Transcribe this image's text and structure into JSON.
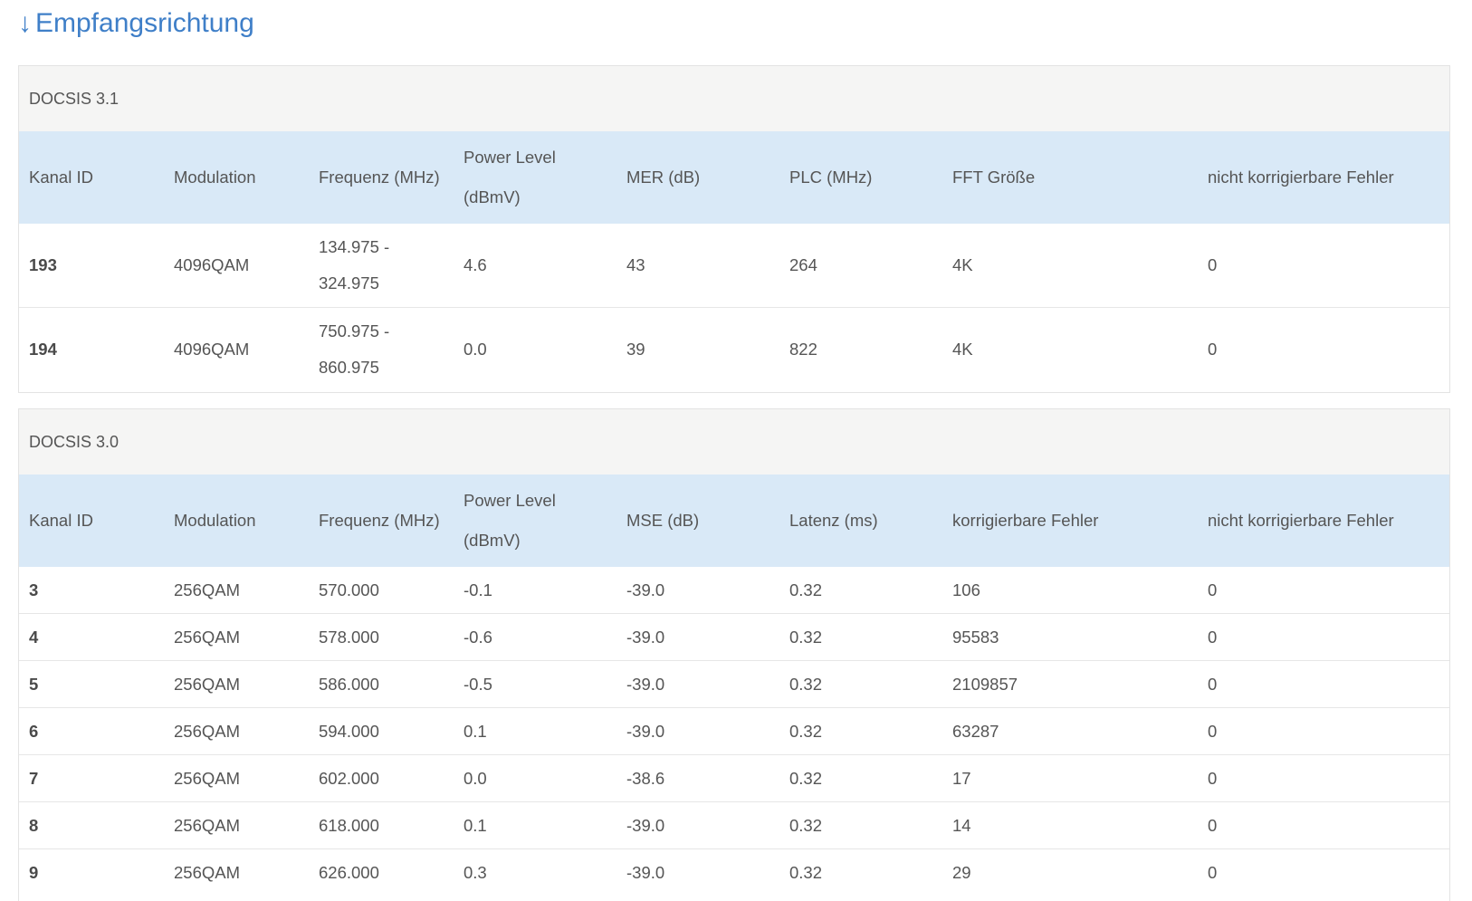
{
  "heading": {
    "arrow": "↓",
    "title": "Empfangsrichtung"
  },
  "docsis31": {
    "title": "DOCSIS 3.1",
    "columns": {
      "kanal_id": "Kanal ID",
      "modulation": "Modulation",
      "frequenz": "Frequenz (MHz)",
      "power": "Power Level (dBmV)",
      "mer": "MER (dB)",
      "plc": "PLC (MHz)",
      "fft": "FFT Größe",
      "nicht_korr": "nicht korrigierbare Fehler"
    },
    "rows": [
      {
        "kanal_id": "193",
        "modulation": "4096QAM",
        "frequenz": "134.975 - 324.975",
        "power": "4.6",
        "mer": "43",
        "plc": "264",
        "fft": "4K",
        "nicht_korr": "0"
      },
      {
        "kanal_id": "194",
        "modulation": "4096QAM",
        "frequenz": "750.975 - 860.975",
        "power": "0.0",
        "mer": "39",
        "plc": "822",
        "fft": "4K",
        "nicht_korr": "0"
      }
    ]
  },
  "docsis30": {
    "title": "DOCSIS 3.0",
    "columns": {
      "kanal_id": "Kanal ID",
      "modulation": "Modulation",
      "frequenz": "Frequenz (MHz)",
      "power": "Power Level (dBmV)",
      "mse": "MSE (dB)",
      "latenz": "Latenz (ms)",
      "korr": "korrigierbare Fehler",
      "nicht_korr": "nicht korrigierbare Fehler"
    },
    "rows": [
      {
        "kanal_id": "3",
        "modulation": "256QAM",
        "frequenz": "570.000",
        "power": "-0.1",
        "mse": "-39.0",
        "latenz": "0.32",
        "korr": "106",
        "nicht_korr": "0"
      },
      {
        "kanal_id": "4",
        "modulation": "256QAM",
        "frequenz": "578.000",
        "power": "-0.6",
        "mse": "-39.0",
        "latenz": "0.32",
        "korr": "95583",
        "nicht_korr": "0"
      },
      {
        "kanal_id": "5",
        "modulation": "256QAM",
        "frequenz": "586.000",
        "power": "-0.5",
        "mse": "-39.0",
        "latenz": "0.32",
        "korr": "2109857",
        "nicht_korr": "0"
      },
      {
        "kanal_id": "6",
        "modulation": "256QAM",
        "frequenz": "594.000",
        "power": "0.1",
        "mse": "-39.0",
        "latenz": "0.32",
        "korr": "63287",
        "nicht_korr": "0"
      },
      {
        "kanal_id": "7",
        "modulation": "256QAM",
        "frequenz": "602.000",
        "power": "0.0",
        "mse": "-38.6",
        "latenz": "0.32",
        "korr": "17",
        "nicht_korr": "0"
      },
      {
        "kanal_id": "8",
        "modulation": "256QAM",
        "frequenz": "618.000",
        "power": "0.1",
        "mse": "-39.0",
        "latenz": "0.32",
        "korr": "14",
        "nicht_korr": "0"
      },
      {
        "kanal_id": "9",
        "modulation": "256QAM",
        "frequenz": "626.000",
        "power": "0.3",
        "mse": "-39.0",
        "latenz": "0.32",
        "korr": "29",
        "nicht_korr": "0"
      }
    ]
  },
  "colors": {
    "heading": "#3f7fc8",
    "header_row": "#d9e9f7",
    "panel_title_bg": "#f5f5f4",
    "text": "#555555"
  }
}
